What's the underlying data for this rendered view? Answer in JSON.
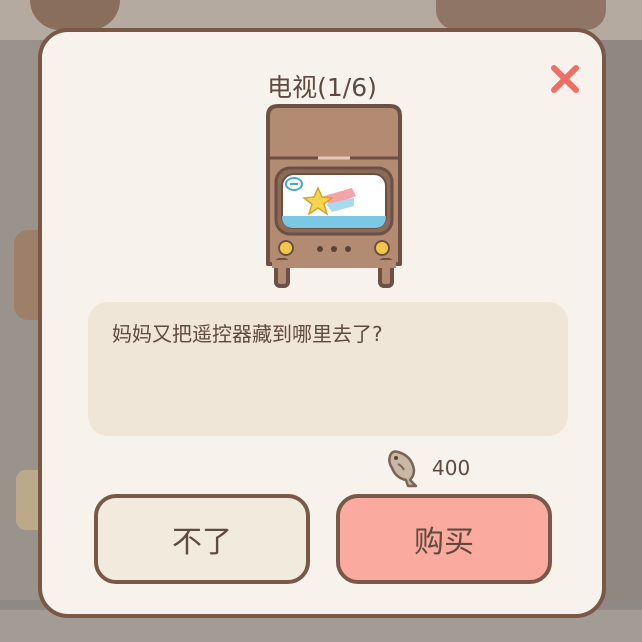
{
  "dialog": {
    "title": "电视(1/6)",
    "item_icon": "tv-icon",
    "description": "妈妈又把遥控器藏到哪里去了?",
    "price": {
      "icon": "fish-currency-icon",
      "value": "400"
    },
    "buttons": {
      "decline_label": "不了",
      "buy_label": "购买"
    },
    "close_icon": "close-icon"
  },
  "colors": {
    "dialog_background": "#f7f3ec",
    "border": "#7a5848",
    "text": "#5e4a40",
    "description_box": "#f0e6d8",
    "decline_button": "#f1ebdd",
    "buy_button": "#fbaaa0",
    "close_icon": "#ee6e66"
  }
}
